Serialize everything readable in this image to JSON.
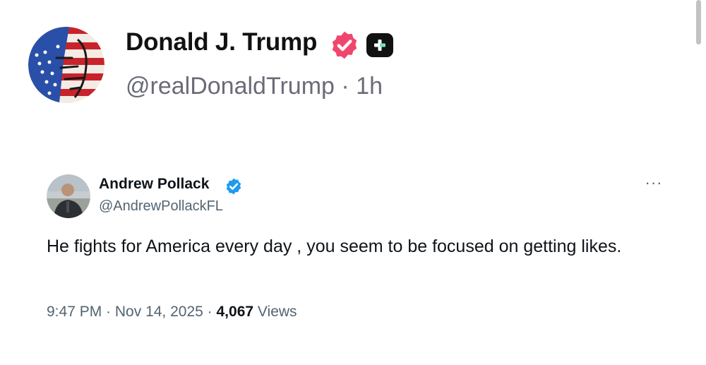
{
  "post": {
    "author_name": "Donald J. Trump",
    "handle": "@realDonaldTrump",
    "separator": " · ",
    "time_ago": "1h",
    "verified_badge_color": "#f0466e"
  },
  "quoted_tweet": {
    "author_name": "Andrew Pollack",
    "handle": "@AndrewPollackFL",
    "text": "He fights for America every day , you seem to be focused on getting likes.",
    "time": "9:47 PM",
    "date": "Nov 14, 2025",
    "separator": " · ",
    "views_count": "4,067",
    "views_label": "Views",
    "more_label": "···",
    "verified_badge_color": "#1d9bf0"
  }
}
